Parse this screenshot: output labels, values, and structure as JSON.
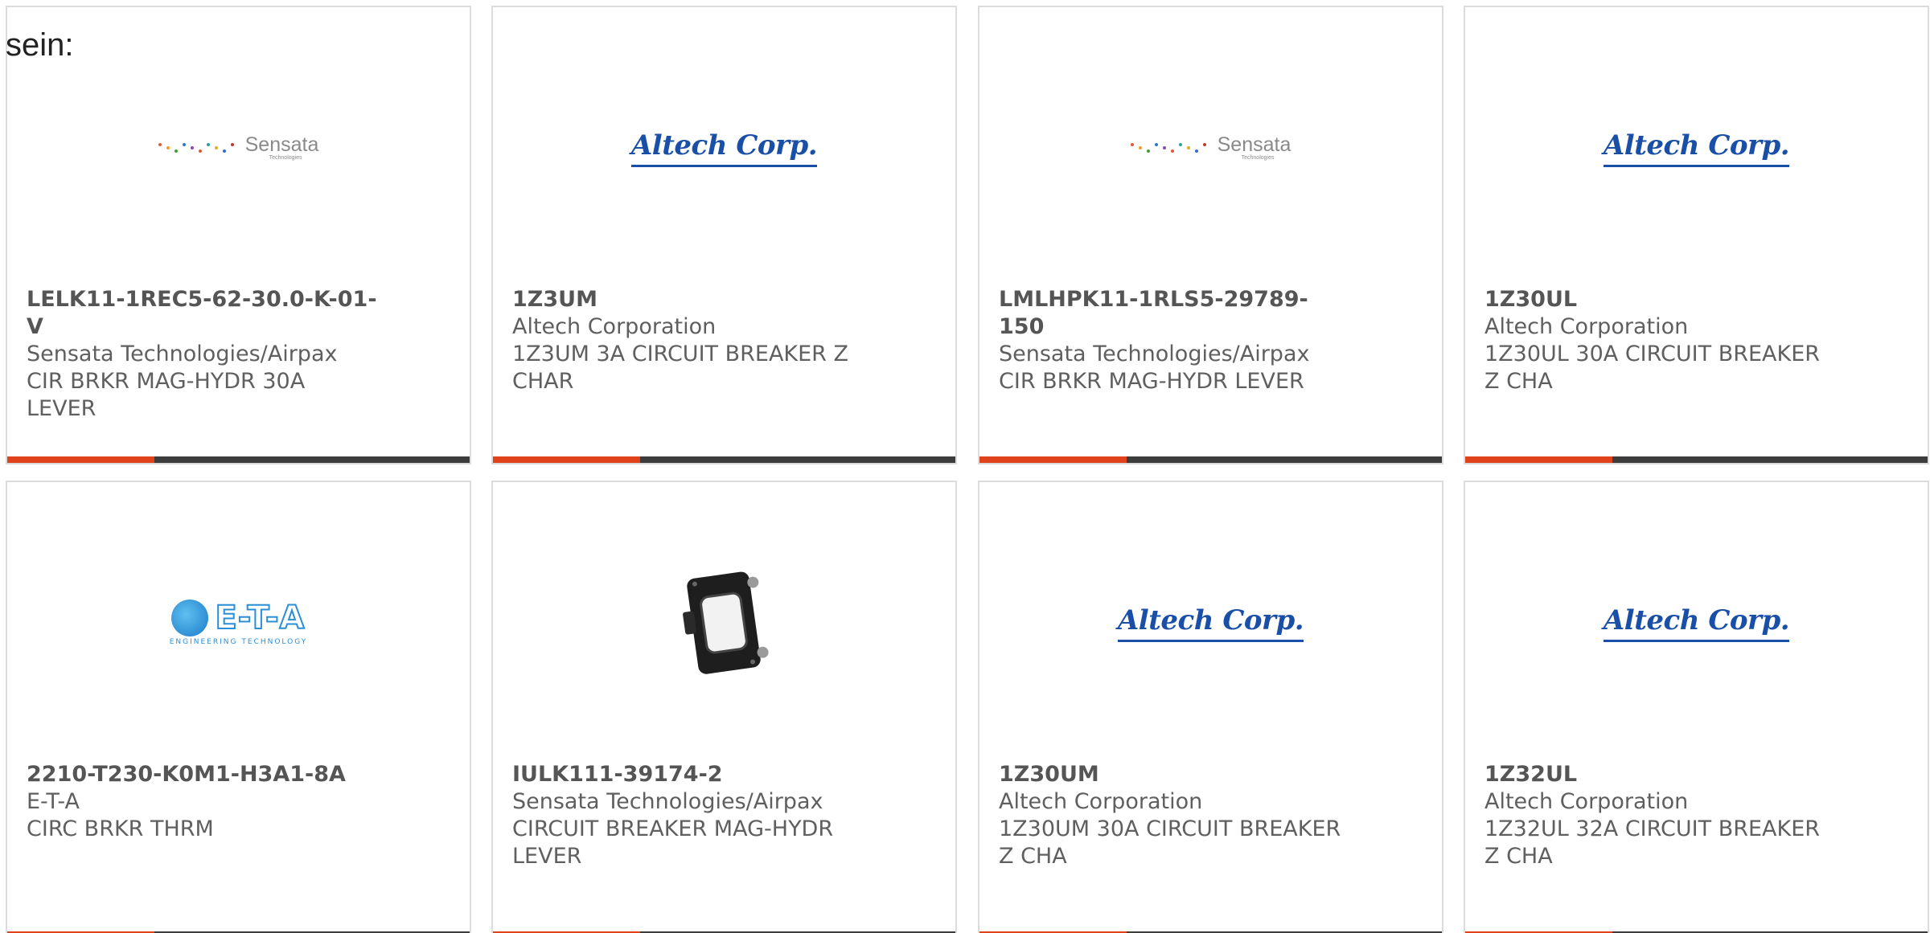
{
  "intro_text": "sein:",
  "accent_color": "#e0431c",
  "bar_color": "#3c3c3c",
  "cards": [
    {
      "part_number": "LELK11-1REC5-62-30.0-K-01-V",
      "manufacturer": "Sensata Technologies/Airpax",
      "description": "CIR BRKR MAG-HYDR 30A LEVER",
      "logo_type": "sensata",
      "logo_text": "Sensata",
      "logo_subtext": "Technologies"
    },
    {
      "part_number": "1Z3UM",
      "manufacturer": "Altech Corporation",
      "description": "1Z3UM 3A CIRCUIT BREAKER Z CHAR",
      "logo_type": "altech",
      "logo_text": "Altech Corp."
    },
    {
      "part_number": "LMLHPK11-1RLS5-29789-150",
      "manufacturer": "Sensata Technologies/Airpax",
      "description": "CIR BRKR MAG-HYDR LEVER",
      "logo_type": "sensata",
      "logo_text": "Sensata",
      "logo_subtext": "Technologies"
    },
    {
      "part_number": "1Z30UL",
      "manufacturer": "Altech Corporation",
      "description": "1Z30UL 30A CIRCUIT BREAKER Z CHA",
      "logo_type": "altech",
      "logo_text": "Altech Corp."
    },
    {
      "part_number": "2210-T230-K0M1-H3A1-8A",
      "manufacturer": "E-T-A",
      "description": "CIRC BRKR THRM",
      "logo_type": "eta",
      "logo_text": "E-T-A",
      "logo_subtext": "ENGINEERING TECHNOLOGY"
    },
    {
      "part_number": "IULK111-39174-2",
      "manufacturer": "Sensata Technologies/Airpax",
      "description": "CIRCUIT BREAKER MAG-HYDR LEVER",
      "logo_type": "product-photo"
    },
    {
      "part_number": "1Z30UM",
      "manufacturer": "Altech Corporation",
      "description": "1Z30UM 30A CIRCUIT BREAKER Z CHA",
      "logo_type": "altech",
      "logo_text": "Altech Corp."
    },
    {
      "part_number": "1Z32UL",
      "manufacturer": "Altech Corporation",
      "description": "1Z32UL 32A CIRCUIT BREAKER Z CHA",
      "logo_type": "altech",
      "logo_text": "Altech Corp."
    }
  ]
}
